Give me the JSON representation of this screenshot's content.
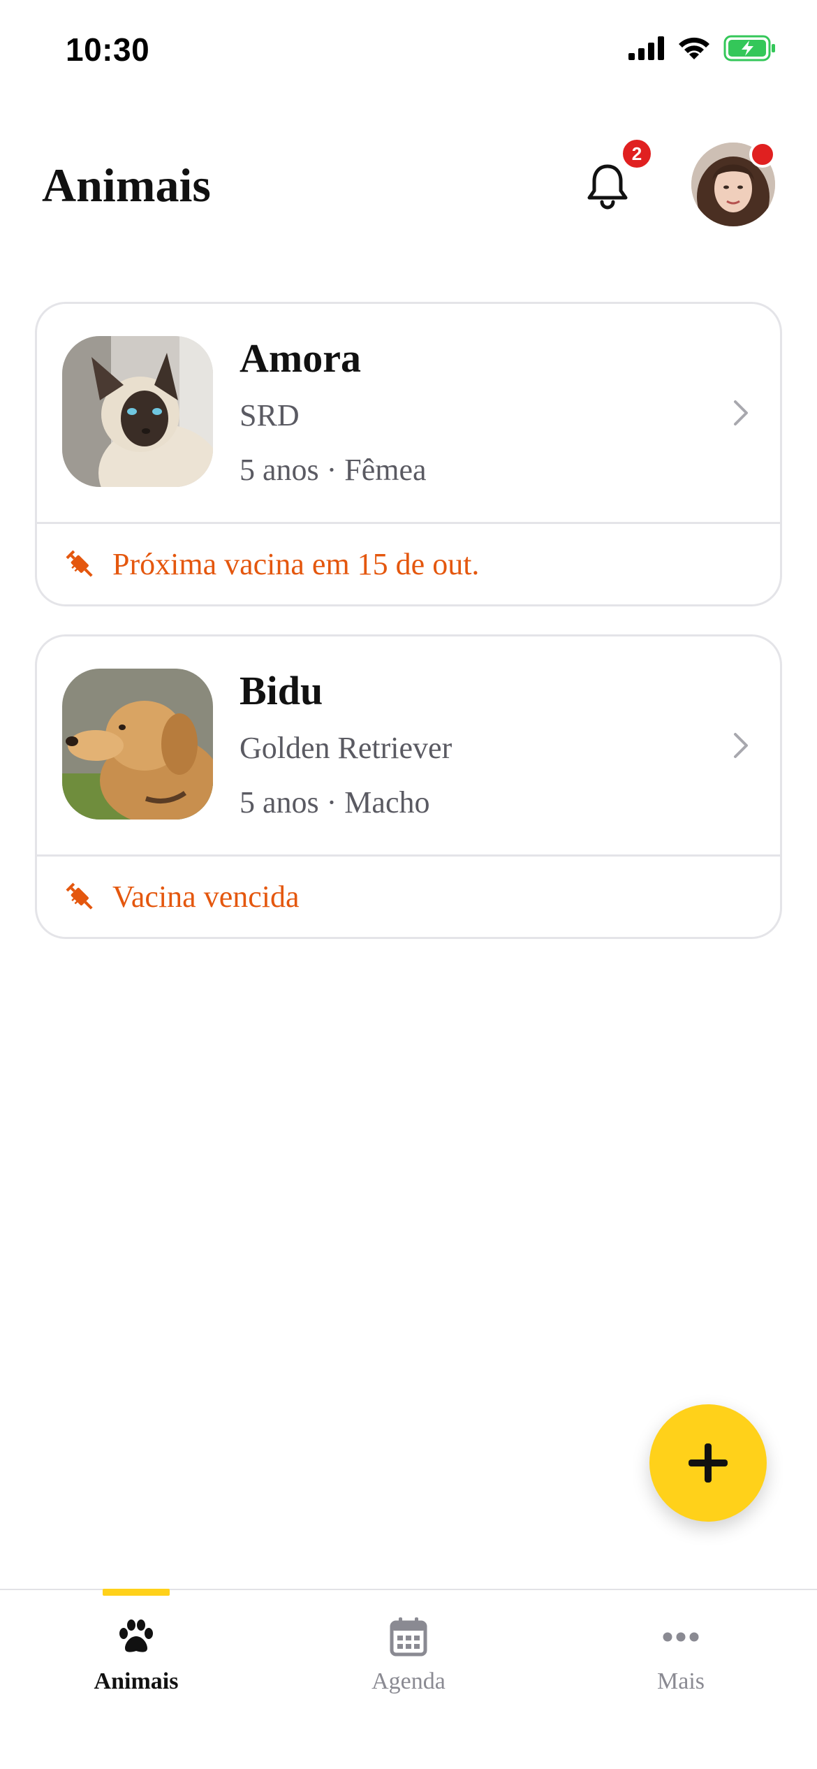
{
  "status_bar": {
    "time": "10:30"
  },
  "header": {
    "title": "Animais",
    "notification_count": "2"
  },
  "pets": [
    {
      "name": "Amora",
      "breed": "SRD",
      "info": "5 anos · Fêmea",
      "alert": "Próxima vacina em 15 de out."
    },
    {
      "name": "Bidu",
      "breed": "Golden Retriever",
      "info": "5 anos · Macho",
      "alert": "Vacina vencida"
    }
  ],
  "tabs": [
    {
      "label": "Animais",
      "icon": "paw-icon",
      "active": true
    },
    {
      "label": "Agenda",
      "icon": "calendar-icon",
      "active": false
    },
    {
      "label": "Mais",
      "icon": "more-icon",
      "active": false
    }
  ],
  "colors": {
    "accent": "#FFD11A",
    "alert": "#E4570E",
    "badge": "#E02020"
  }
}
